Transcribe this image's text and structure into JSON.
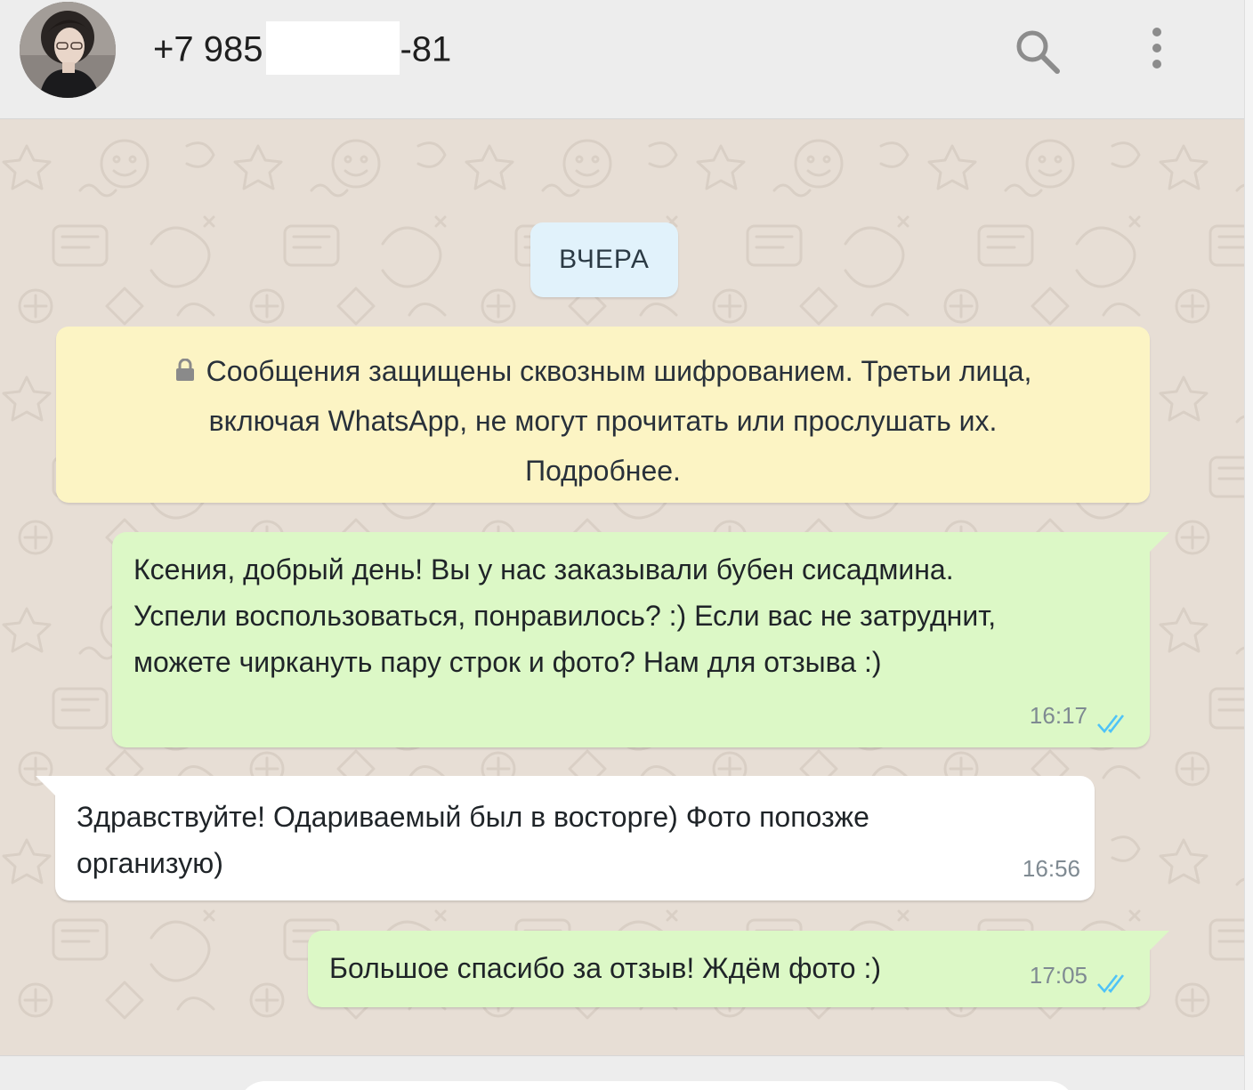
{
  "header": {
    "contact_name_prefix": "+7 985",
    "contact_name_suffix": "-81",
    "avatar_icon": "contact-avatar",
    "search_icon": "search-icon",
    "menu_icon": "more-vertical-icon"
  },
  "chat": {
    "date_chip": "ВЧЕРА",
    "encryption_notice": {
      "line1": "Сообщения защищены сквозным шифрованием. Третьи лица,",
      "line2": "включая WhatsApp, не могут прочитать или прослушать их.",
      "line3": "Подробнее."
    },
    "messages": [
      {
        "direction": "outgoing",
        "lines": [
          "Ксения, добрый день! Вы у нас заказывали бубен сисадмина.",
          "Успели воспользоваться, понравилось? :) Если вас не затруднит,",
          "можете чиркануть пару строк и фото? Нам для отзыва :)"
        ],
        "time": "16:17",
        "status": "read"
      },
      {
        "direction": "incoming",
        "lines": [
          "Здравствуйте! Одариваемый был в восторге) Фото попозже",
          "организую)"
        ],
        "time": "16:56"
      },
      {
        "direction": "outgoing",
        "lines": [
          "Большое спасибо за отзыв! Ждём фото :)"
        ],
        "time": "17:05",
        "status": "read"
      }
    ]
  },
  "colors": {
    "header_bg": "#ededed",
    "chat_bg": "#e7ded5",
    "outgoing_bubble": "#dcf8c6",
    "incoming_bubble": "#ffffff",
    "date_chip_bg": "#e1f2fb",
    "notice_bg": "#fcf4c4",
    "read_ticks": "#4fc3f7"
  }
}
